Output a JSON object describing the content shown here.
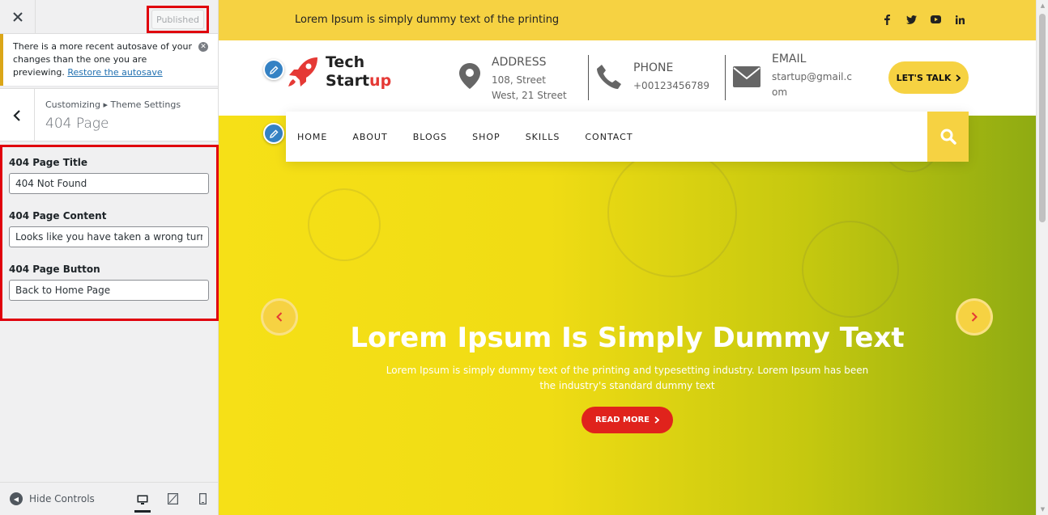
{
  "customizer": {
    "publish_label": "Published",
    "autosave_text": "There is a more recent autosave of your changes than the one you are previewing.",
    "autosave_link": "Restore the autosave",
    "breadcrumb": "Customizing ▸ Theme Settings",
    "section_title": "404 Page",
    "fields": [
      {
        "label": "404 Page Title",
        "value": "404 Not Found"
      },
      {
        "label": "404 Page Content",
        "value": "Looks like you have taken a wrong turn&hellip;"
      },
      {
        "label": "404 Page Button",
        "value": "Back to Home Page"
      }
    ],
    "hide_controls": "Hide Controls"
  },
  "site": {
    "topbar_text": "Lorem Ipsum is simply dummy text of the printing",
    "socials": [
      "facebook-icon",
      "twitter-icon",
      "youtube-icon",
      "linkedin-icon"
    ],
    "logo_line1": "Tech",
    "logo_line2a": "Start",
    "logo_line2b": "up",
    "address_label": "ADDRESS",
    "address_value": "108, Street West, 21 Street",
    "phone_label": "PHONE",
    "phone_value": "+00123456789",
    "email_label": "EMAIL",
    "email_value": "startup@gmail.com",
    "cta_label": "LET'S TALK",
    "nav": [
      "HOME",
      "ABOUT",
      "BLOGS",
      "SHOP",
      "SKILLS",
      "CONTACT"
    ],
    "hero_title": "Lorem Ipsum Is Simply Dummy Text",
    "hero_subtitle": "Lorem Ipsum is simply dummy text of the printing and typesetting industry. Lorem Ipsum has been the industry's standard dummy text",
    "hero_button": "READ MORE"
  },
  "colors": {
    "accent_yellow": "#f6d242",
    "accent_red": "#e0231c",
    "highlight_red": "#e0000d",
    "wp_blue": "#3582c4"
  }
}
